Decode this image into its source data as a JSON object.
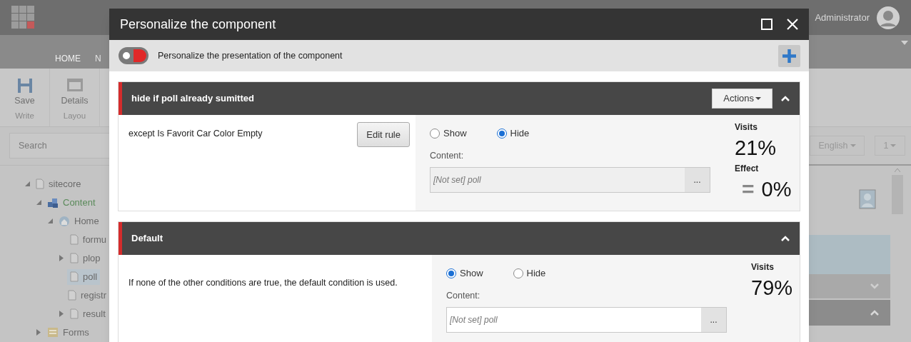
{
  "app": {
    "user": "Administrator",
    "ribbon_tabs": [
      {
        "label": "HOME",
        "selected": true
      },
      {
        "label": "N",
        "selected": false
      }
    ],
    "toolbar": [
      {
        "label": "Save",
        "group": "Write",
        "kind": "save"
      },
      {
        "label": "Details",
        "group": "Layou",
        "kind": "details"
      }
    ],
    "search": {
      "placeholder": "Search"
    },
    "language": "English",
    "version": "1",
    "tree": [
      {
        "label": "sitecore",
        "kind": "page",
        "expanded": true,
        "selected": false,
        "children": [
          {
            "label": "Content",
            "kind": "content",
            "expanded": true,
            "selected": false,
            "children": [
              {
                "label": "Home",
                "kind": "home",
                "expanded": true,
                "selected": false,
                "children": [
                  {
                    "label": "formu",
                    "kind": "page",
                    "selected": false
                  },
                  {
                    "label": "plop",
                    "kind": "page",
                    "expanded": false,
                    "has_children": true,
                    "selected": false
                  },
                  {
                    "label": "poll",
                    "kind": "page",
                    "selected": true
                  },
                  {
                    "label": "registr",
                    "kind": "page",
                    "selected": false
                  },
                  {
                    "label": "result",
                    "kind": "page",
                    "expanded": false,
                    "has_children": true,
                    "selected": false
                  }
                ]
              }
            ]
          },
          {
            "label": "Forms",
            "kind": "forms",
            "expanded": false,
            "has_children": true,
            "selected": false
          }
        ]
      }
    ]
  },
  "dialog": {
    "title": "Personalize the component",
    "toggle": {
      "label": "Personalize the presentation of the component",
      "on": true
    },
    "sections": [
      {
        "kind": "rule",
        "name": "hide if poll already sumitted",
        "expanded": true,
        "actions": "Actions",
        "condition": "except Is Favorit Car Color Empty",
        "edit_button": "Edit rule",
        "options": [
          {
            "label": "Show",
            "selected": false
          },
          {
            "label": "Hide",
            "selected": true
          }
        ],
        "content_label": "Content:",
        "content_placeholder": "[Not set] poll",
        "browse": "...",
        "visits_label": "Visits",
        "visits": "21%",
        "effect_label": "Effect",
        "effect_sign": "=",
        "effect": "0%"
      },
      {
        "kind": "default",
        "name": "Default",
        "expanded": true,
        "condition": "If none of the other conditions are true, the default condition is used.",
        "options": [
          {
            "label": "Show",
            "selected": true
          },
          {
            "label": "Hide",
            "selected": false
          }
        ],
        "content_label": "Content:",
        "content_placeholder": "[Not set] poll",
        "browse": "...",
        "visits_label": "Visits",
        "visits": "79%"
      }
    ]
  }
}
